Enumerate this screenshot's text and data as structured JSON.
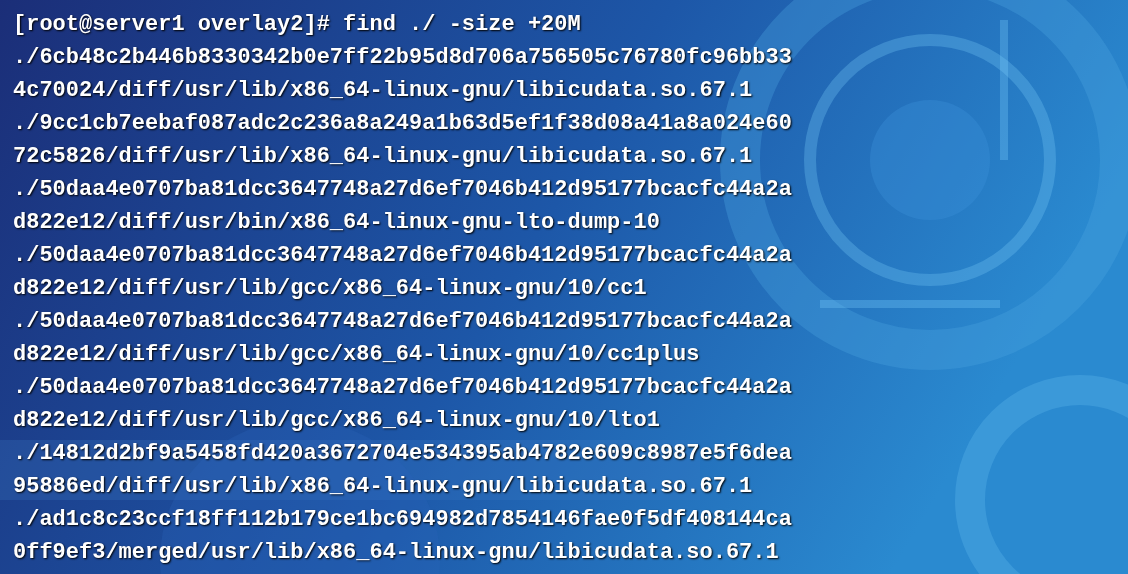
{
  "terminal": {
    "lines": [
      "[root@server1 overlay2]# find ./ -size +20M",
      "./6cb48c2b446b8330342b0e7ff22b95d8d706a756505c76780fc96bb33",
      "4c70024/diff/usr/lib/x86_64-linux-gnu/libicudata.so.67.1",
      "./9cc1cb7eebaf087adc2c236a8a249a1b63d5ef1f38d08a41a8a024e60",
      "72c5826/diff/usr/lib/x86_64-linux-gnu/libicudata.so.67.1",
      "./50daa4e0707ba81dcc3647748a27d6ef7046b412d95177bcacfc44a2a",
      "d822e12/diff/usr/bin/x86_64-linux-gnu-lto-dump-10",
      "./50daa4e0707ba81dcc3647748a27d6ef7046b412d95177bcacfc44a2a",
      "d822e12/diff/usr/lib/gcc/x86_64-linux-gnu/10/cc1",
      "./50daa4e0707ba81dcc3647748a27d6ef7046b412d95177bcacfc44a2a",
      "d822e12/diff/usr/lib/gcc/x86_64-linux-gnu/10/cc1plus",
      "./50daa4e0707ba81dcc3647748a27d6ef7046b412d95177bcacfc44a2a",
      "d822e12/diff/usr/lib/gcc/x86_64-linux-gnu/10/lto1",
      "./14812d2bf9a5458fd420a3672704e534395ab4782e609c8987e5f6dea",
      "95886ed/diff/usr/lib/x86_64-linux-gnu/libicudata.so.67.1",
      "./ad1c8c23ccf18ff112b179ce1bc694982d7854146fae0f5df408144ca",
      "0ff9ef3/merged/usr/lib/x86_64-linux-gnu/libicudata.so.67.1"
    ]
  }
}
